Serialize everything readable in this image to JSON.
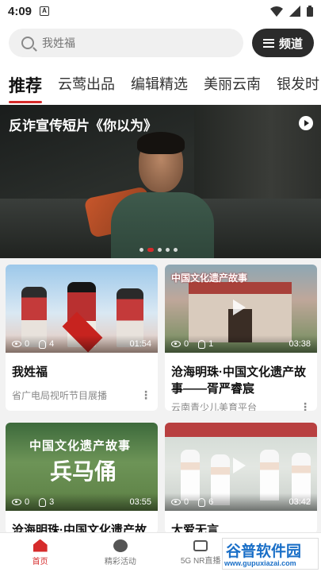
{
  "status_bar": {
    "time": "4:09",
    "sim_badge": "A"
  },
  "search": {
    "placeholder": "我姓福"
  },
  "channel_button": {
    "label": "频道"
  },
  "tabs": [
    {
      "label": "推荐",
      "active": true
    },
    {
      "label": "云莺出品"
    },
    {
      "label": "编辑精选"
    },
    {
      "label": "美丽云南"
    },
    {
      "label": "银发时"
    }
  ],
  "banner": {
    "title": "反诈宣传短片《你以为》",
    "slides": 5,
    "active_slide": 2
  },
  "cards": [
    {
      "title": "我姓福",
      "source": "省广电局视听节目展播",
      "views": "0",
      "likes": "4",
      "duration": "01:54"
    },
    {
      "title": "沧海明珠·中国文化遗产故事——胥严睿宸",
      "source": "云南青少儿美育平台",
      "views": "0",
      "likes": "1",
      "duration": "03:38"
    },
    {
      "title": "沧海明珠·中国文化遗产故",
      "source": "",
      "views": "0",
      "likes": "3",
      "duration": "03:55"
    },
    {
      "title": "大爱无言",
      "source": "",
      "views": "0",
      "likes": "6",
      "duration": "03:42"
    }
  ],
  "thumb_texts": {
    "card2_top": "中国文化遗产故事",
    "card3_top": "中国文化遗产故事",
    "card3_big": "兵马俑"
  },
  "bottom_nav": [
    {
      "label": "首页",
      "active": true
    },
    {
      "label": "精彩活动"
    },
    {
      "label": "5G NR直播"
    }
  ],
  "watermark": {
    "main": "谷普软件园",
    "url": "www.gupuxiazai.com"
  },
  "colors": {
    "accent": "#d62b2b",
    "channel_bg": "#2b2b2b"
  }
}
